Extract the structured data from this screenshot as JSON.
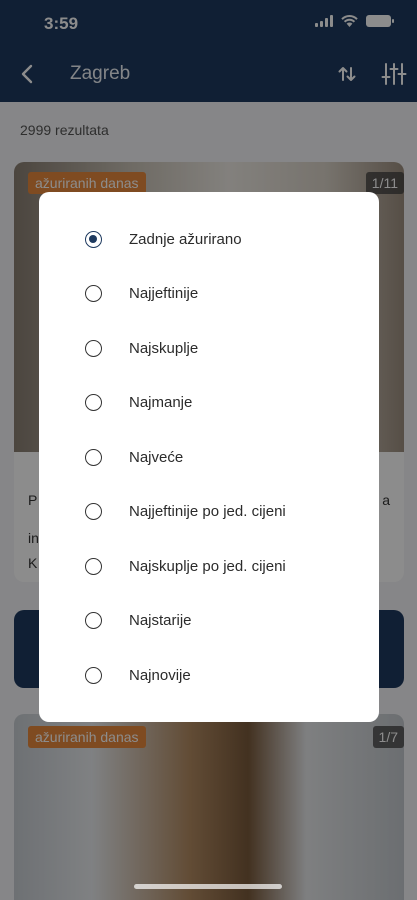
{
  "status": {
    "time": "3:59"
  },
  "header": {
    "title": "Zagreb"
  },
  "results": {
    "count_text": "2999 rezultata"
  },
  "listings": [
    {
      "badge": "ažuriranih danas",
      "counter": "1/11",
      "text_left_1": "P",
      "text_right_1": "a",
      "text_left_2": "in",
      "text_left_3": "K"
    },
    {
      "badge": "ažuriranih danas",
      "counter": "1/7"
    }
  ],
  "sort_dialog": {
    "selected_index": 0,
    "options": [
      "Zadnje ažurirano",
      "Najjeftinije",
      "Najskuplje",
      "Najmanje",
      "Najveće",
      "Najjeftinije po jed. cijeni",
      "Najskuplje po jed. cijeni",
      "Najstarije",
      "Najnovije"
    ]
  },
  "icons": {
    "back": "arrow-left-icon",
    "sort": "sort-arrows-icon",
    "filter": "filter-sliders-icon"
  },
  "colors": {
    "primary": "#1e3a5f",
    "badge": "#e8893c"
  }
}
